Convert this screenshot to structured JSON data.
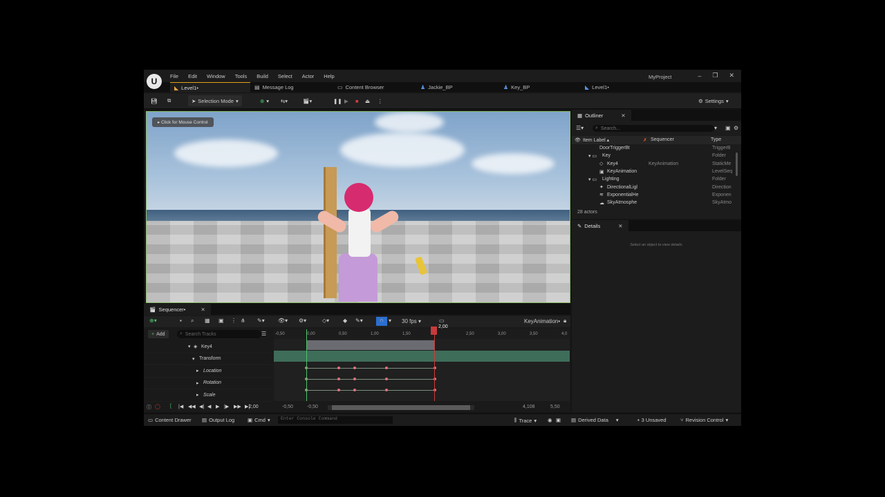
{
  "menu": [
    "File",
    "Edit",
    "Window",
    "Tools",
    "Build",
    "Select",
    "Actor",
    "Help"
  ],
  "project_name": "MyProject",
  "tabs": [
    {
      "label": "Level1•",
      "active": true
    },
    {
      "label": "Message Log",
      "active": false
    },
    {
      "label": "Content Browser",
      "active": false
    },
    {
      "label": "Jackie_BP",
      "active": false
    },
    {
      "label": "Key_BP",
      "active": false
    },
    {
      "label": "Level1•",
      "active": false
    }
  ],
  "toolbar": {
    "selection_mode": "Selection Mode",
    "settings": "Settings"
  },
  "viewport": {
    "mouse_control": "Click for Mouse Control"
  },
  "outliner": {
    "title": "Outliner",
    "search_placeholder": "Search...",
    "col_label": "Item Label ▴",
    "col_seq": "Sequencer",
    "col_type": "Type",
    "rows": [
      {
        "label": "DoorTriggerBt",
        "seq": "",
        "type": "TriggerB"
      },
      {
        "label": "Key",
        "seq": "",
        "type": "Folder"
      },
      {
        "label": "Key4",
        "seq": "KeyAnimation",
        "type": "StaticMe"
      },
      {
        "label": "KeyAnimation",
        "seq": "",
        "type": "LevelSeq"
      },
      {
        "label": "Lighting",
        "seq": "",
        "type": "Folder"
      },
      {
        "label": "DirectionalLigl",
        "seq": "",
        "type": "Direction"
      },
      {
        "label": "ExponentialHe",
        "seq": "",
        "type": "Exponen"
      },
      {
        "label": "SkyAtmosphe",
        "seq": "",
        "type": "SkyAtmo"
      }
    ],
    "actors": "28 actors"
  },
  "details": {
    "title": "Details",
    "empty": "Select an object to view details."
  },
  "sequencer": {
    "title": "Sequencer•",
    "fps": "30 fps",
    "sequence_name": "KeyAnimation•",
    "add": "Add",
    "search_placeholder": "Search Tracks",
    "tracks": [
      "Key4",
      "Transform",
      "Location",
      "Rotation",
      "Scale"
    ],
    "ruler": [
      "-0,50",
      "0,00",
      "0,50",
      "1,00",
      "1,50",
      "2,00",
      "2,50",
      "3,00",
      "3,50",
      "4,0"
    ],
    "current_time": "2,00",
    "range_start_a": "-0,50",
    "range_start_b": "-0,50",
    "range_end_a": "4,108",
    "range_end_b": "5,50",
    "key_times": [
      0.0,
      0.5,
      0.75,
      1.25,
      2.0
    ]
  },
  "statusbar": {
    "content_drawer": "Content Drawer",
    "output_log": "Output Log",
    "cmd": "Cmd",
    "console_placeholder": "Enter Console Command",
    "trace": "Trace",
    "derived_data": "Derived Data",
    "unsaved": "3 Unsaved",
    "revision_control": "Revision Control"
  },
  "colors": {
    "accent_orange": "#e2a21b",
    "keyframe": "#e0707a",
    "playhead": "#d03a3a",
    "selection_blue": "#2c6fd1"
  }
}
